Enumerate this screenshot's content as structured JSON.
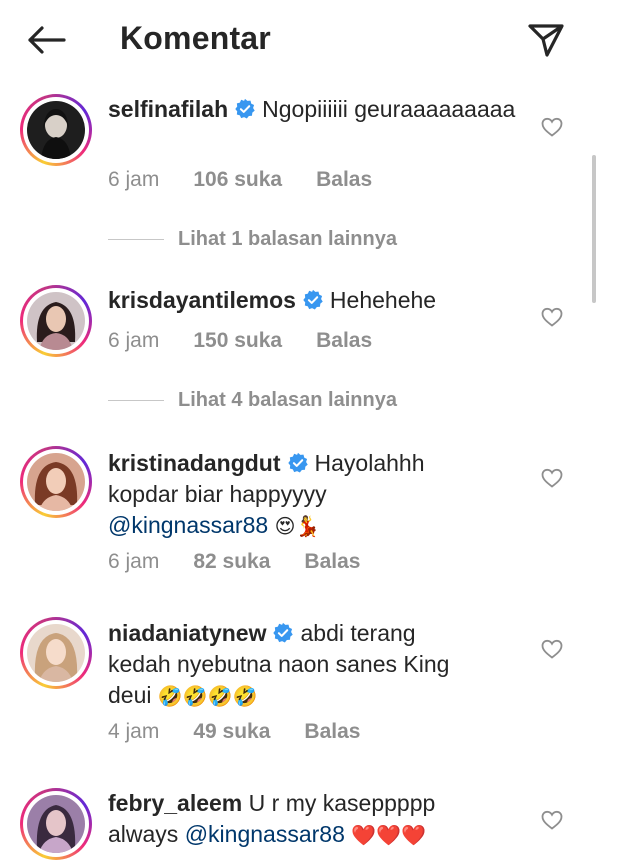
{
  "header": {
    "title": "Komentar",
    "back_icon": "back-arrow-icon",
    "share_icon": "paper-plane-icon"
  },
  "comments": [
    {
      "username": "selfinafilah",
      "text": "Ngopiiiiii geuraaaaaaaaa",
      "time": "6 jam",
      "likes": "106 suka",
      "reply": "Balas",
      "view_replies": "Lihat 1 balasan lainnya"
    },
    {
      "username": "krisdayantilemos",
      "text": "Hehehehe",
      "time": "6 jam",
      "likes": "150 suka",
      "reply": "Balas",
      "view_replies": "Lihat 4 balasan lainnya"
    },
    {
      "username": "kristinadangdut",
      "text_line1": "Hayolahhh",
      "text_line2": "kopdar biar happyyyy",
      "mention": "@kingnassar88",
      "emoji": "😍💃",
      "time": "6 jam",
      "likes": "82 suka",
      "reply": "Balas"
    },
    {
      "username": "niadaniatynew",
      "text_line1": "abdi terang",
      "text_line2": "kedah nyebutna naon sanes King",
      "text_line3": "deui",
      "emoji": "🤣🤣🤣🤣",
      "time": "4 jam",
      "likes": "49 suka",
      "reply": "Balas"
    },
    {
      "username": "febry_aleem",
      "text_line1": "U r my kaseppppp",
      "text_line2": "always",
      "mention": "@kingnassar88",
      "emoji": "❤️❤️❤️"
    }
  ],
  "colors": {
    "text": "#262626",
    "secondary": "#8e8e8e",
    "verified": "#3897f0",
    "mention": "#00376b"
  }
}
